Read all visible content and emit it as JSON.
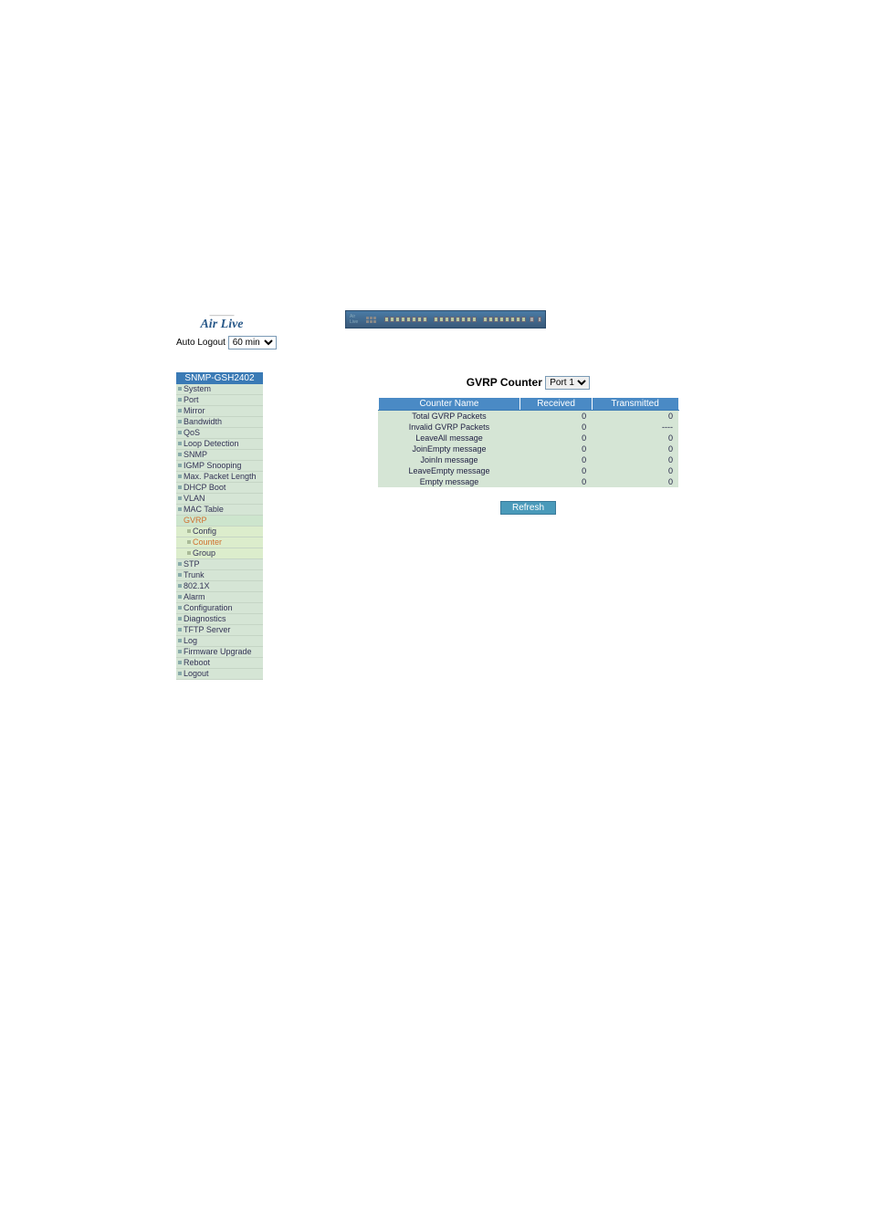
{
  "brand": {
    "name": "Air Live"
  },
  "auto_logout": {
    "label": "Auto Logout",
    "selected": "60 min"
  },
  "sidebar": {
    "title": "SNMP-GSH2402",
    "items": [
      {
        "label": "System",
        "type": "item"
      },
      {
        "label": "Port",
        "type": "item"
      },
      {
        "label": "Mirror",
        "type": "item"
      },
      {
        "label": "Bandwidth",
        "type": "item"
      },
      {
        "label": "QoS",
        "type": "item"
      },
      {
        "label": "Loop Detection",
        "type": "item"
      },
      {
        "label": "SNMP",
        "type": "item"
      },
      {
        "label": "IGMP Snooping",
        "type": "item"
      },
      {
        "label": "Max. Packet Length",
        "type": "item"
      },
      {
        "label": "DHCP Boot",
        "type": "item"
      },
      {
        "label": "VLAN",
        "type": "item"
      },
      {
        "label": "MAC Table",
        "type": "item"
      },
      {
        "label": "GVRP",
        "type": "selected"
      },
      {
        "label": "Config",
        "type": "sub"
      },
      {
        "label": "Counter",
        "type": "sub-active"
      },
      {
        "label": "Group",
        "type": "sub"
      },
      {
        "label": "STP",
        "type": "item"
      },
      {
        "label": "Trunk",
        "type": "item"
      },
      {
        "label": "802.1X",
        "type": "item"
      },
      {
        "label": "Alarm",
        "type": "item"
      },
      {
        "label": "Configuration",
        "type": "item"
      },
      {
        "label": "Diagnostics",
        "type": "item"
      },
      {
        "label": "TFTP Server",
        "type": "item"
      },
      {
        "label": "Log",
        "type": "item"
      },
      {
        "label": "Firmware Upgrade",
        "type": "item"
      },
      {
        "label": "Reboot",
        "type": "item"
      },
      {
        "label": "Logout",
        "type": "item"
      }
    ]
  },
  "content": {
    "title": "GVRP Counter",
    "port_selected": "Port 1",
    "table": {
      "headers": [
        "Counter Name",
        "Received",
        "Transmitted"
      ],
      "rows": [
        {
          "name": "Total GVRP Packets",
          "received": "0",
          "transmitted": "0"
        },
        {
          "name": "Invalid GVRP Packets",
          "received": "0",
          "transmitted": "----"
        },
        {
          "name": "LeaveAll message",
          "received": "0",
          "transmitted": "0"
        },
        {
          "name": "JoinEmpty message",
          "received": "0",
          "transmitted": "0"
        },
        {
          "name": "JoinIn message",
          "received": "0",
          "transmitted": "0"
        },
        {
          "name": "LeaveEmpty message",
          "received": "0",
          "transmitted": "0"
        },
        {
          "name": "Empty message",
          "received": "0",
          "transmitted": "0"
        }
      ]
    },
    "refresh_label": "Refresh"
  }
}
